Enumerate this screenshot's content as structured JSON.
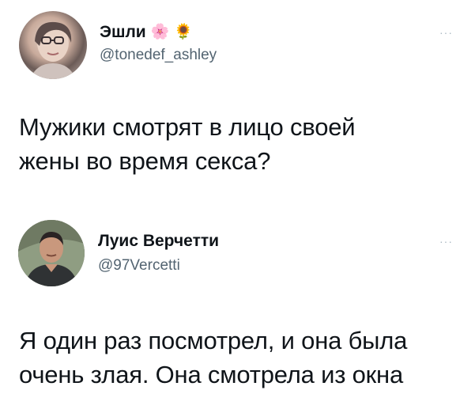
{
  "tweets": [
    {
      "display_name": "Эшли",
      "emojis": [
        "🌸",
        "🌻"
      ],
      "handle": "@tonedef_ashley",
      "more": "···",
      "text": "Мужики смотрят в лицо своей\nжены во время секса?",
      "avatar_icon": "user-photo"
    },
    {
      "display_name": "Луис Верчетти",
      "emojis": [],
      "handle": "@97Vercetti",
      "more": "···",
      "text": "Я один раз посмотрел, и она была\nочень злая. Она смотрела из окна",
      "avatar_icon": "user-photo"
    }
  ],
  "colors": {
    "text": "#0f1419",
    "secondary": "#536471",
    "more": "#aab8c2",
    "background": "#ffffff"
  }
}
